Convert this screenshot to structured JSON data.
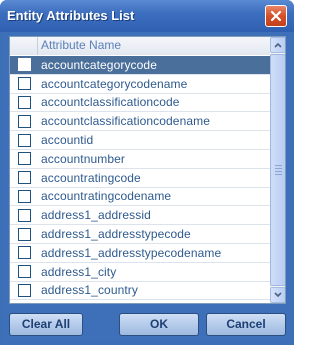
{
  "window": {
    "title": "Entity Attributes List"
  },
  "list": {
    "header": "Attribute Name",
    "selected_index": 0,
    "items": [
      {
        "label": "accountcategorycode",
        "checked": false
      },
      {
        "label": "accountcategorycodename",
        "checked": false
      },
      {
        "label": "accountclassificationcode",
        "checked": false
      },
      {
        "label": "accountclassificationcodename",
        "checked": false
      },
      {
        "label": "accountid",
        "checked": false
      },
      {
        "label": "accountnumber",
        "checked": false
      },
      {
        "label": "accountratingcode",
        "checked": false
      },
      {
        "label": "accountratingcodename",
        "checked": false
      },
      {
        "label": "address1_addressid",
        "checked": false
      },
      {
        "label": "address1_addresstypecode",
        "checked": false
      },
      {
        "label": "address1_addresstypecodename",
        "checked": false
      },
      {
        "label": "address1_city",
        "checked": false
      },
      {
        "label": "address1_country",
        "checked": false
      }
    ]
  },
  "buttons": {
    "clear_all": "Clear All",
    "ok": "OK",
    "cancel": "Cancel"
  },
  "icons": {
    "close": "close-icon",
    "scroll_up": "chevron-up-icon",
    "scroll_down": "chevron-down-icon"
  },
  "colors": {
    "title_bar": "#3d6fc0",
    "client": "#3d70b8",
    "selected_row": "#4a6f9a",
    "row_text": "#2e5a8e",
    "close_button": "#d4502a"
  }
}
